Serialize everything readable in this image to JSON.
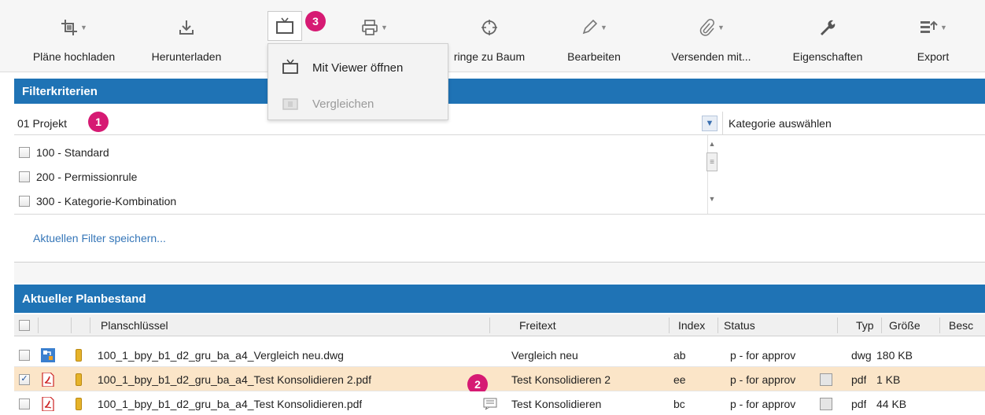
{
  "toolbar": {
    "items": [
      {
        "label": "Pläne hochladen",
        "icon": "crop-icon",
        "caret": true
      },
      {
        "label": "Herunterladen",
        "icon": "download-icon",
        "caret": false
      },
      {
        "label": "",
        "icon": "viewer-icon",
        "caret": false
      },
      {
        "label": "",
        "icon": "printer-icon",
        "caret": true
      },
      {
        "label": "ringe zu Baum",
        "icon": "target-icon",
        "caret": false
      },
      {
        "label": "Bearbeiten",
        "icon": "pencil-icon",
        "caret": true
      },
      {
        "label": "Versenden mit...",
        "icon": "paperclip-icon",
        "caret": true
      },
      {
        "label": "Eigenschaften",
        "icon": "wrench-icon",
        "caret": false
      },
      {
        "label": "Export",
        "icon": "export-icon",
        "caret": true
      }
    ]
  },
  "dropdown": {
    "items": [
      {
        "label": "Mit Viewer öffnen",
        "disabled": false
      },
      {
        "label": "Vergleichen",
        "disabled": true
      }
    ]
  },
  "badges": {
    "one": "1",
    "two": "2",
    "three": "3"
  },
  "filter": {
    "title": "Filterkriterien",
    "project": "01 Projekt",
    "category_placeholder": "Kategorie auswählen",
    "categories": [
      {
        "label": "100 - Standard"
      },
      {
        "label": "200 - Permissionrule"
      },
      {
        "label": "300 - Kategorie-Kombination"
      }
    ],
    "save_link": "Aktuellen Filter speichern..."
  },
  "plans": {
    "title": "Aktueller Planbestand",
    "columns": {
      "key": "Planschlüssel",
      "text": "Freitext",
      "index": "Index",
      "status": "Status",
      "type": "Typ",
      "size": "Größe",
      "extra": "Besc"
    },
    "rows": [
      {
        "checked": false,
        "file_icon": "dwg-file-icon",
        "key": "100_1_bpy_b1_d2_gru_ba_a4_Vergleich neu.dwg",
        "text": "Vergleich neu",
        "index": "ab",
        "status": "p - for approv",
        "type": "dwg",
        "size": "180 KB",
        "selected": false
      },
      {
        "checked": true,
        "file_icon": "pdf-file-icon",
        "key": "100_1_bpy_b1_d2_gru_ba_a4_Test Konsolidieren 2.pdf",
        "text": "Test Konsolidieren 2",
        "index": "ee",
        "status": "p - for approv",
        "type": "pdf",
        "size": "1 KB",
        "selected": true
      },
      {
        "checked": false,
        "file_icon": "pdf-file-icon",
        "key": "100_1_bpy_b1_d2_gru_ba_a4_Test Konsolidieren.pdf",
        "text": "Test Konsolidieren",
        "index": "bc",
        "status": "p - for approv",
        "type": "pdf",
        "size": "44 KB",
        "selected": false
      }
    ]
  },
  "colors": {
    "accent": "#1f73b5",
    "badge": "#d61a73",
    "selected_row": "#fbe5c8",
    "link": "#3576b8"
  }
}
